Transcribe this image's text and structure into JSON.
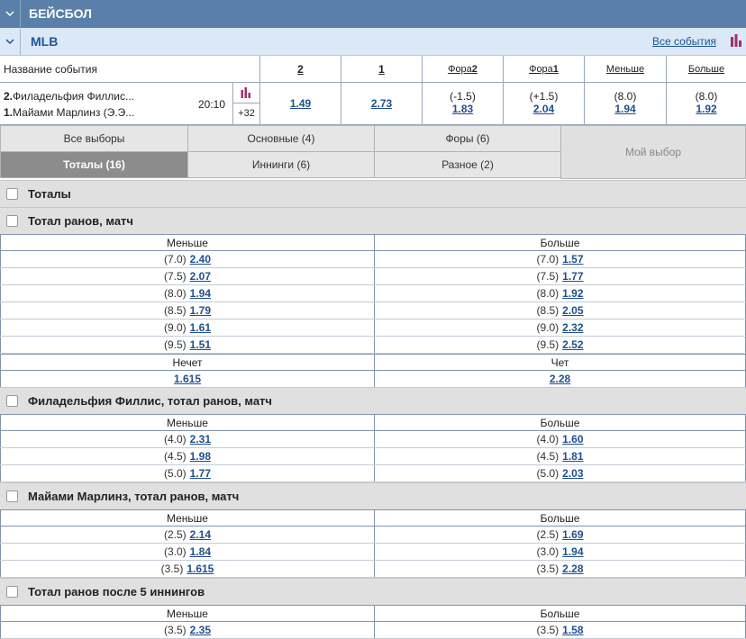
{
  "sport": {
    "title": "БЕЙСБОЛ"
  },
  "league": {
    "name": "MLB",
    "all_events": "Все события"
  },
  "columns": {
    "event_name": "Название события",
    "c2": "2",
    "c1": "1",
    "fora2_prefix": "Фора",
    "fora2_suffix": "2",
    "fora1_prefix": "Фора",
    "fora1_suffix": "1",
    "less": "Меньше",
    "more": "Больше"
  },
  "event": {
    "team1_num": "2.",
    "team1": "Филадельфия Филлис...",
    "team2_num": "1.",
    "team2": "Майами Марлинз (Э.Э...",
    "time": "20:10",
    "more_count": "+32",
    "odd2": "1.49",
    "odd1": "2.73",
    "fora2_param": "(-1.5)",
    "fora2_odd": "1.83",
    "fora1_param": "(+1.5)",
    "fora1_odd": "2.04",
    "less_param": "(8.0)",
    "less_odd": "1.94",
    "more_param": "(8.0)",
    "more_odd": "1.92"
  },
  "tabs": {
    "all": "Все выборы",
    "main": "Основные (4)",
    "foras": "Форы (6)",
    "totals": "Тоталы (16)",
    "innings": "Иннинги (6)",
    "misc": "Разное (2)",
    "mine": "Мой выбор"
  },
  "sections": {
    "totals": "Тоталы",
    "total_runs": {
      "title": "Тотал ранов, матч",
      "less_hdr": "Меньше",
      "more_hdr": "Больше",
      "rows": [
        {
          "lp": "(7.0)",
          "lo": "2.40",
          "rp": "(7.0)",
          "ro": "1.57"
        },
        {
          "lp": "(7.5)",
          "lo": "2.07",
          "rp": "(7.5)",
          "ro": "1.77"
        },
        {
          "lp": "(8.0)",
          "lo": "1.94",
          "rp": "(8.0)",
          "ro": "1.92"
        },
        {
          "lp": "(8.5)",
          "lo": "1.79",
          "rp": "(8.5)",
          "ro": "2.05"
        },
        {
          "lp": "(9.0)",
          "lo": "1.61",
          "rp": "(9.0)",
          "ro": "2.32"
        },
        {
          "lp": "(9.5)",
          "lo": "1.51",
          "rp": "(9.5)",
          "ro": "2.52"
        }
      ],
      "odd_hdr": "Нечет",
      "even_hdr": "Чет",
      "odd_val": "1.615",
      "even_val": "2.28"
    },
    "phil": {
      "title": "Филадельфия Филлис, тотал ранов, матч",
      "less_hdr": "Меньше",
      "more_hdr": "Больше",
      "rows": [
        {
          "lp": "(4.0)",
          "lo": "2.31",
          "rp": "(4.0)",
          "ro": "1.60"
        },
        {
          "lp": "(4.5)",
          "lo": "1.98",
          "rp": "(4.5)",
          "ro": "1.81"
        },
        {
          "lp": "(5.0)",
          "lo": "1.77",
          "rp": "(5.0)",
          "ro": "2.03"
        }
      ]
    },
    "miami": {
      "title": "Майами Марлинз, тотал ранов, матч",
      "less_hdr": "Меньше",
      "more_hdr": "Больше",
      "rows": [
        {
          "lp": "(2.5)",
          "lo": "2.14",
          "rp": "(2.5)",
          "ro": "1.69"
        },
        {
          "lp": "(3.0)",
          "lo": "1.84",
          "rp": "(3.0)",
          "ro": "1.94"
        },
        {
          "lp": "(3.5)",
          "lo": "1.615",
          "rp": "(3.5)",
          "ro": "2.28"
        }
      ]
    },
    "after5": {
      "title": "Тотал ранов после 5 иннингов",
      "less_hdr": "Меньше",
      "more_hdr": "Больше",
      "rows": [
        {
          "lp": "(3.5)",
          "lo": "2.35",
          "rp": "(3.5)",
          "ro": "1.58"
        }
      ]
    }
  },
  "colors": {
    "sport_bar": "#5a7fa8",
    "league_bar": "#dbe8f5",
    "link": "#1f4f8f",
    "stats_icon": "#a0306a"
  }
}
